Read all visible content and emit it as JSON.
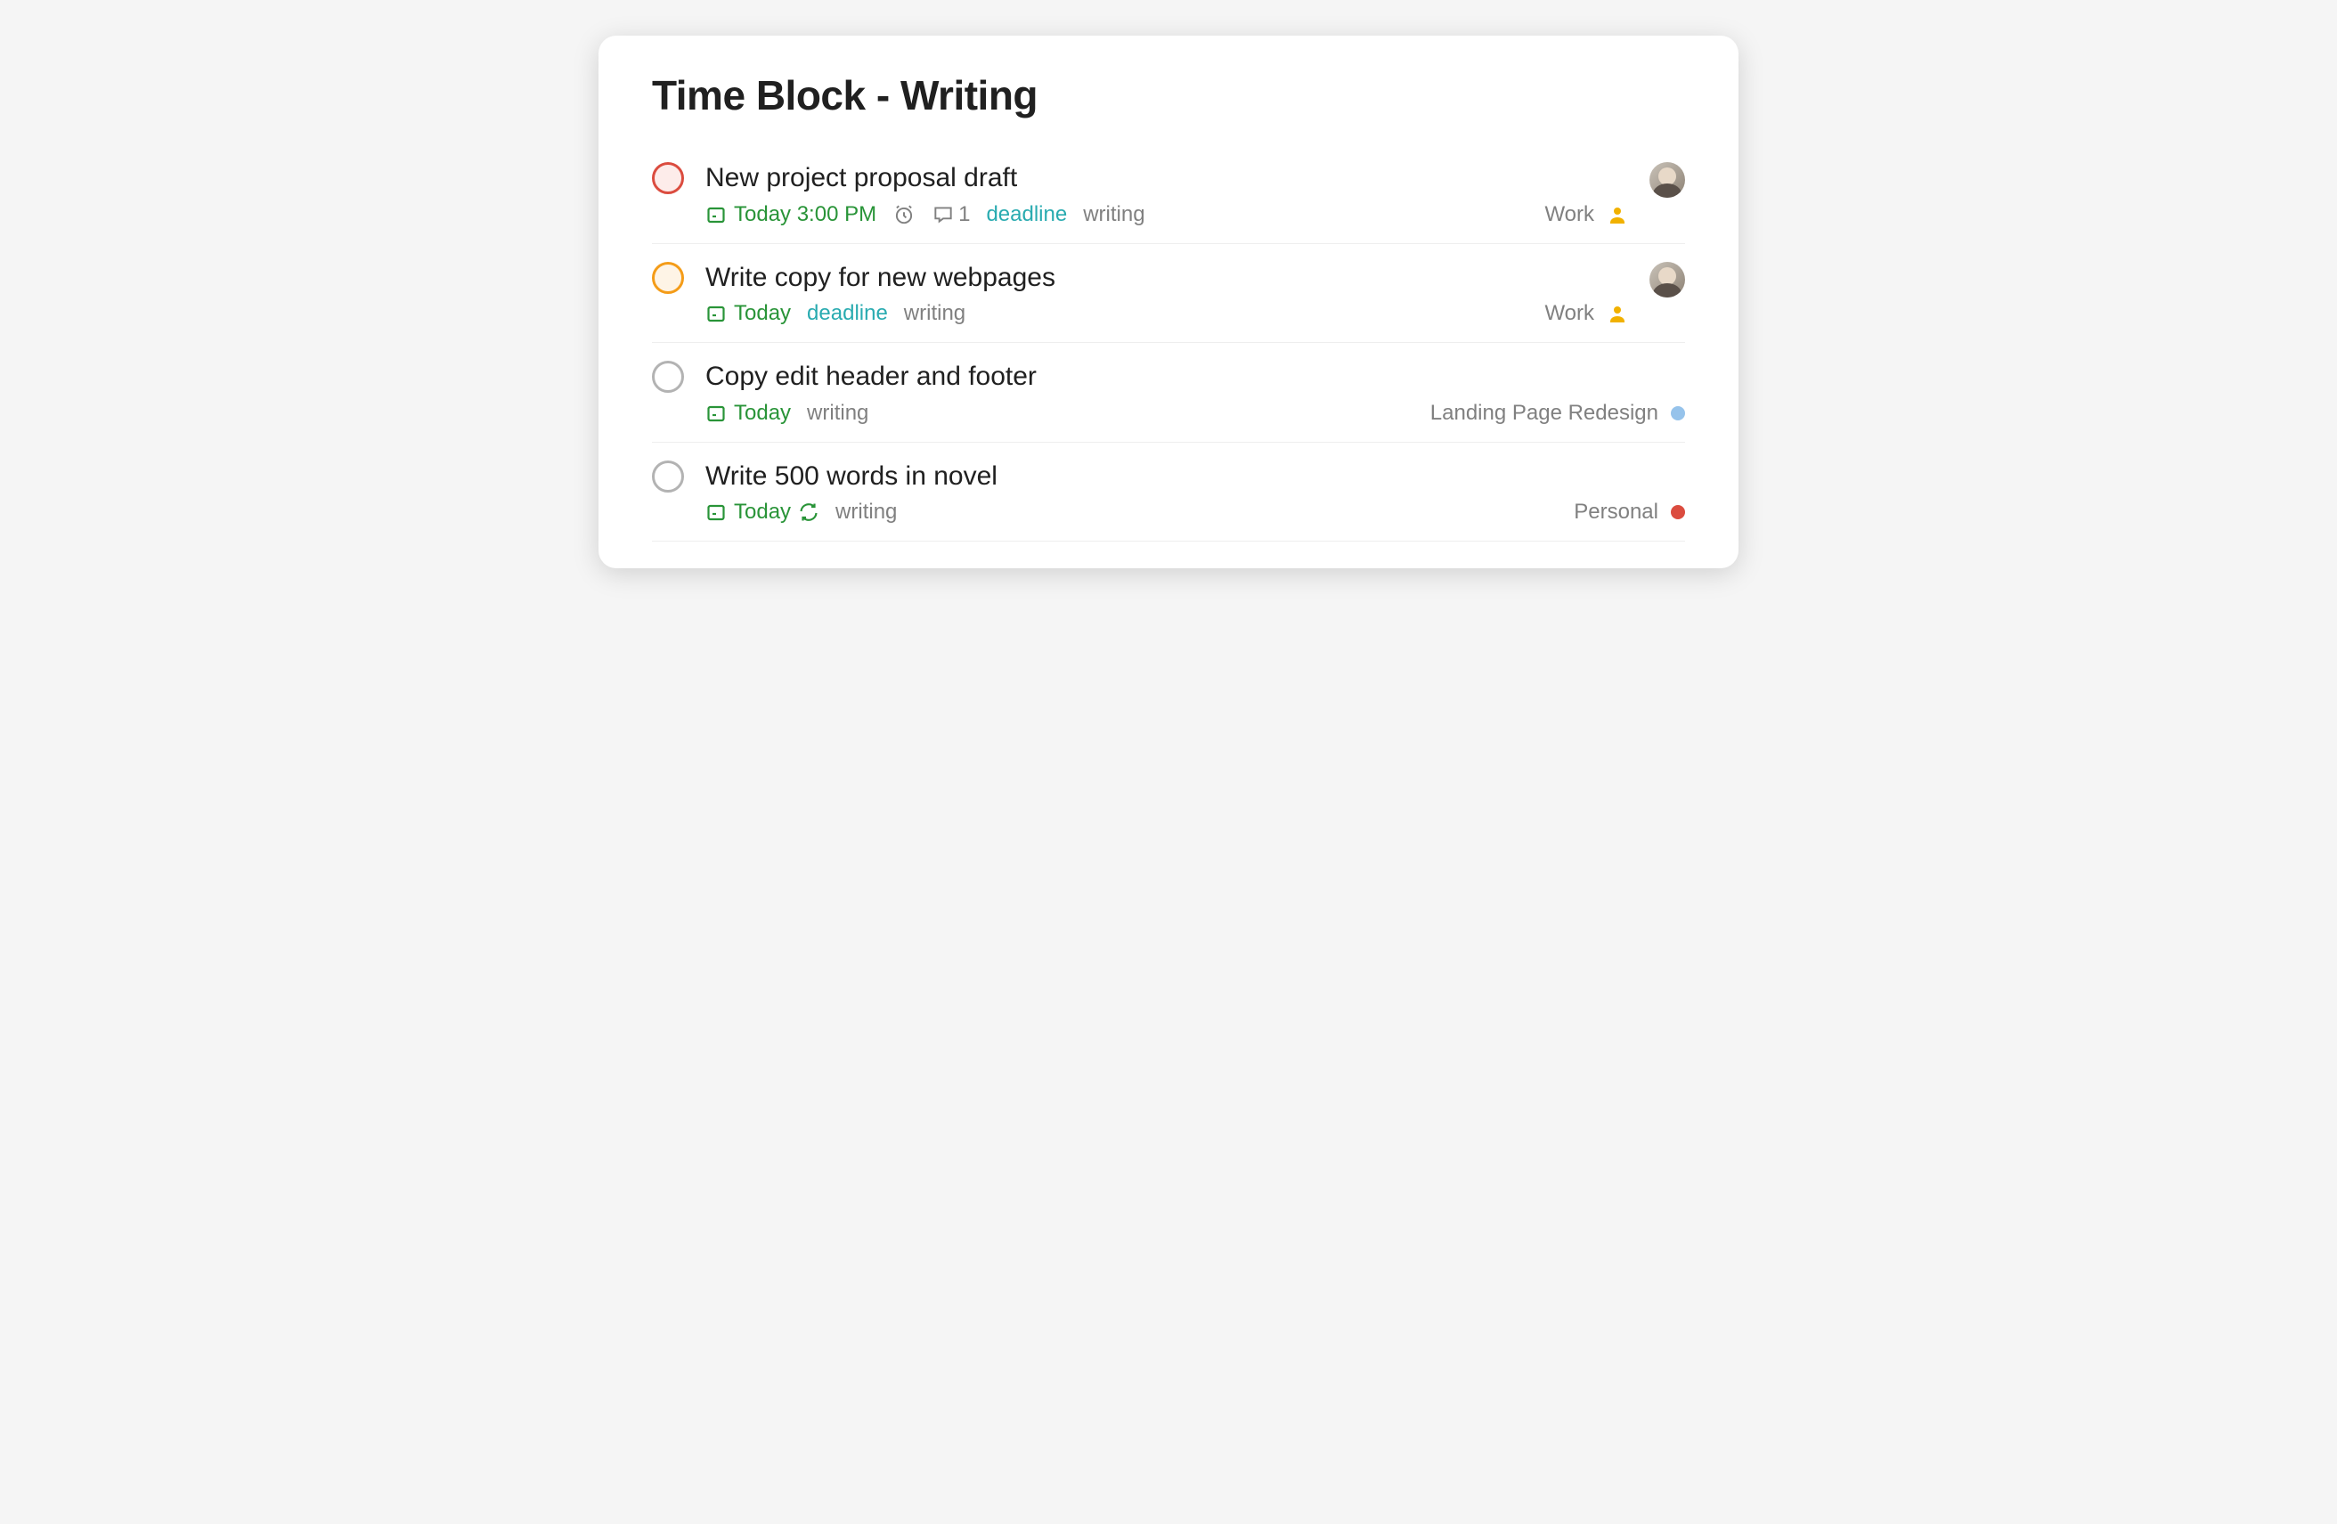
{
  "title": "Time Block - Writing",
  "tasks": [
    {
      "title": "New project proposal draft",
      "due": "Today 3:00 PM",
      "has_alarm": true,
      "comment_count": "1",
      "tags": [
        "deadline",
        "writing"
      ],
      "project": "Work",
      "has_avatar": true,
      "recurring": false,
      "priority": "p1",
      "project_indicator": "assignee"
    },
    {
      "title": "Write copy for new webpages",
      "due": "Today",
      "has_alarm": false,
      "comment_count": null,
      "tags": [
        "deadline",
        "writing"
      ],
      "project": "Work",
      "has_avatar": true,
      "recurring": false,
      "priority": "p2",
      "project_indicator": "assignee"
    },
    {
      "title": "Copy edit header and footer",
      "due": "Today",
      "has_alarm": false,
      "comment_count": null,
      "tags": [
        "writing"
      ],
      "project": "Landing Page Redesign",
      "has_avatar": false,
      "recurring": false,
      "priority": "p4",
      "project_indicator": "blue"
    },
    {
      "title": "Write 500 words in novel",
      "due": "Today",
      "has_alarm": false,
      "comment_count": null,
      "tags": [
        "writing"
      ],
      "project": "Personal",
      "has_avatar": false,
      "recurring": true,
      "priority": "p4",
      "project_indicator": "red"
    }
  ]
}
